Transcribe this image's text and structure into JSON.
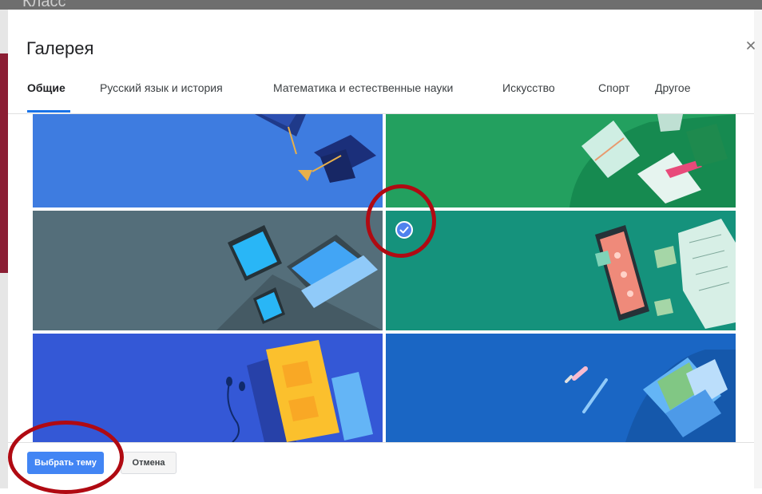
{
  "dialog": {
    "title": "Галерея",
    "close_icon": "close-icon"
  },
  "tabs": [
    {
      "label": "Общие",
      "active": true
    },
    {
      "label": "Русский язык и история",
      "active": false
    },
    {
      "label": "Математика и естественные науки",
      "active": false
    },
    {
      "label": "Искусство",
      "active": false
    },
    {
      "label": "Спорт",
      "active": false
    },
    {
      "label": "Другое",
      "active": false
    }
  ],
  "themes": [
    {
      "name": "graduation-caps",
      "color": "#3e7ce0",
      "selected": false
    },
    {
      "name": "books-and-notes",
      "color": "#23a05f",
      "selected": false
    },
    {
      "name": "tablet-and-laptop",
      "color": "#546e7a",
      "selected": false
    },
    {
      "name": "phone-and-papers",
      "color": "#15927c",
      "selected": true
    },
    {
      "name": "notebook-and-headphones",
      "color": "#3458d6",
      "selected": false
    },
    {
      "name": "backpack-and-pencils",
      "color": "#1a66c4",
      "selected": false
    }
  ],
  "footer": {
    "primary_label": "Выбрать тему",
    "cancel_label": "Отмена"
  },
  "colors": {
    "accent": "#4285f4",
    "tab_indicator": "#1a73e8",
    "annotation": "#b00a12"
  }
}
